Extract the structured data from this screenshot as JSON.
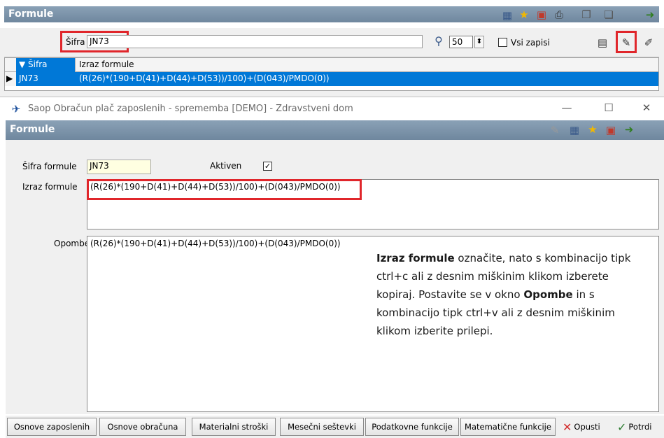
{
  "browse": {
    "title": "Formule",
    "search_label": "Šifra",
    "search_value": "JN73",
    "page_size": "50",
    "all_records_label": "Vsi zapisi",
    "columns": [
      "Šifra",
      "Izraz formule"
    ],
    "rows": [
      {
        "sifra": "JN73",
        "izraz": "(R(26)*(190+D(41)+D(44)+D(53))/100)+(D(043)/PMDO(0))"
      }
    ]
  },
  "dialog": {
    "window_title": "Saop Obračun plač zaposlenih - sprememba [DEMO] - Zdravstveni dom",
    "header": "Formule",
    "sifra_label": "Šifra formule",
    "sifra_value": "JN73",
    "aktiven_label": "Aktiven",
    "aktiven_checked": true,
    "izraz_label": "Izraz formule",
    "izraz_value": "(R(26)*(190+D(41)+D(44)+D(53))/100)+(D(043)/PMDO(0))",
    "opombe_label": "Opombe",
    "opombe_value": "(R(26)*(190+D(41)+D(44)+D(53))/100)+(D(043)/PMDO(0))",
    "note": {
      "bold1": "Izraz formule",
      "text1": " označite, nato s kombinacijo tipk ctrl+c ali z desnim miškinim klikom izberete kopiraj. Postavite se v okno ",
      "bold2": "Opombe",
      "text2": " in s kombinacijo tipk ctrl+v ali z desnim miškinim klikom izberite prilepi."
    },
    "buttons": {
      "osnove_zaposlenih": "Osnove zaposlenih",
      "osnove_obracuna": "Osnove obračuna",
      "materialni_stroski": "Materialni stroški",
      "mesecni_sestevki": "Mesečni seštevki",
      "podatkovne_funkcije": "Podatkovne funkcije",
      "matematicne_funkcije": "Matematične funkcije",
      "opusti": "Opusti",
      "potrdi": "Potrdi"
    }
  },
  "colors": {
    "header_bar": "#7f96ab",
    "selection": "#0078d7",
    "highlight_red": "#e0262b",
    "field_yellow": "#ffffe1"
  },
  "icons": [
    "grid-icon",
    "star-icon",
    "delete-icon",
    "print-icon",
    "copy-icon",
    "copy2-icon",
    "exit-icon",
    "magnifier-icon",
    "new-icon",
    "edit-icon",
    "check-icon",
    "cancel-icon"
  ]
}
